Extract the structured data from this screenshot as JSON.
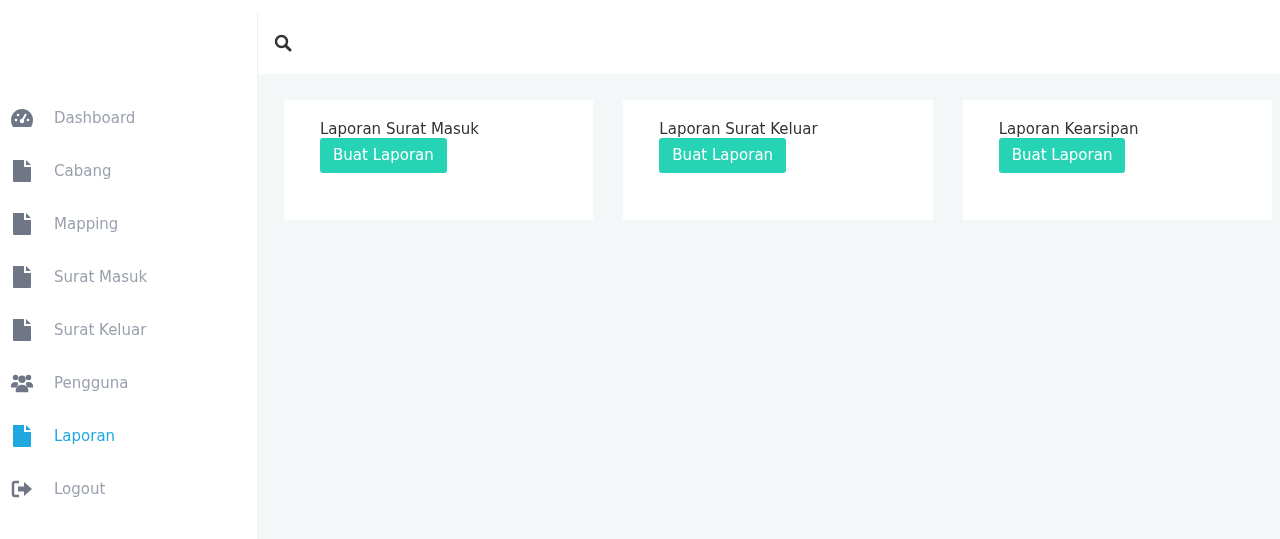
{
  "sidebar": {
    "items": [
      {
        "label": "Dashboard",
        "kind": "gauge",
        "selected": false
      },
      {
        "label": "Cabang",
        "kind": "file",
        "selected": false
      },
      {
        "label": "Mapping",
        "kind": "file",
        "selected": false
      },
      {
        "label": "Surat Masuk",
        "kind": "file",
        "selected": false
      },
      {
        "label": "Surat Keluar",
        "kind": "file",
        "selected": false
      },
      {
        "label": "Pengguna",
        "kind": "users",
        "selected": false
      },
      {
        "label": "Laporan",
        "kind": "file",
        "selected": true
      },
      {
        "label": "Logout",
        "kind": "logout",
        "selected": false
      }
    ]
  },
  "cards": [
    {
      "title": "Laporan Surat Masuk",
      "button": "Buat Laporan"
    },
    {
      "title": "Laporan Surat Keluar",
      "button": "Buat Laporan"
    },
    {
      "title": "Laporan Kearsipan",
      "button": "Buat Laporan"
    }
  ]
}
